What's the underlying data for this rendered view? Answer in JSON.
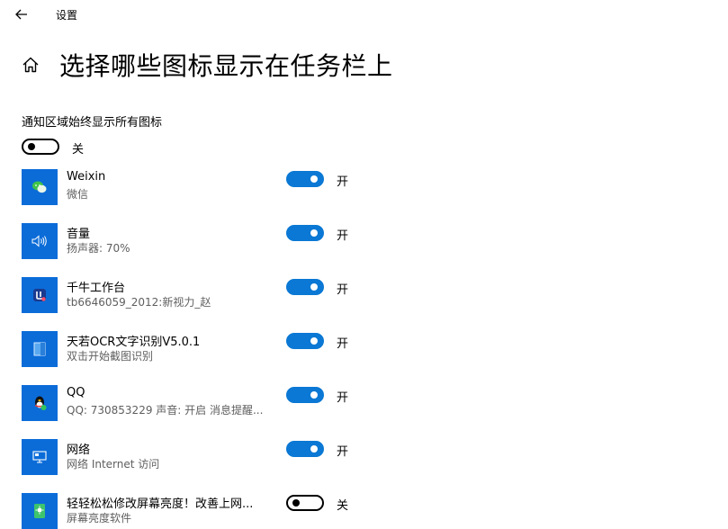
{
  "window": {
    "title": "设置"
  },
  "page": {
    "title": "选择哪些图标显示在任务栏上"
  },
  "master": {
    "label": "通知区域始终显示所有图标",
    "state": "关",
    "on": false
  },
  "apps": [
    {
      "name": "Weixin",
      "desc": "微信",
      "state": "开",
      "on": true,
      "icon": "wechat-icon"
    },
    {
      "name": "音量",
      "desc": "扬声器: 70%",
      "state": "开",
      "on": true,
      "icon": "speaker-icon"
    },
    {
      "name": "千牛工作台",
      "desc": "tb6646059_2012:新视力_赵",
      "state": "开",
      "on": true,
      "icon": "qianniu-icon"
    },
    {
      "name": "天若OCR文字识别V5.0.1",
      "desc": "双击开始截图识别",
      "state": "开",
      "on": true,
      "icon": "ocr-icon"
    },
    {
      "name": "QQ",
      "desc": "QQ: 730853229 声音: 开启 消息提醒...",
      "state": "开",
      "on": true,
      "icon": "qq-icon"
    },
    {
      "name": "网络",
      "desc": "网络 Internet 访问",
      "state": "开",
      "on": true,
      "icon": "network-icon"
    },
    {
      "name": "轻轻松松修改屏幕亮度！改善上网...",
      "desc": "屏幕亮度软件",
      "state": "关",
      "on": false,
      "icon": "brightness-icon"
    }
  ],
  "colors": {
    "accent": "#0a78d4",
    "icon_bg": "#0b6cd8"
  }
}
